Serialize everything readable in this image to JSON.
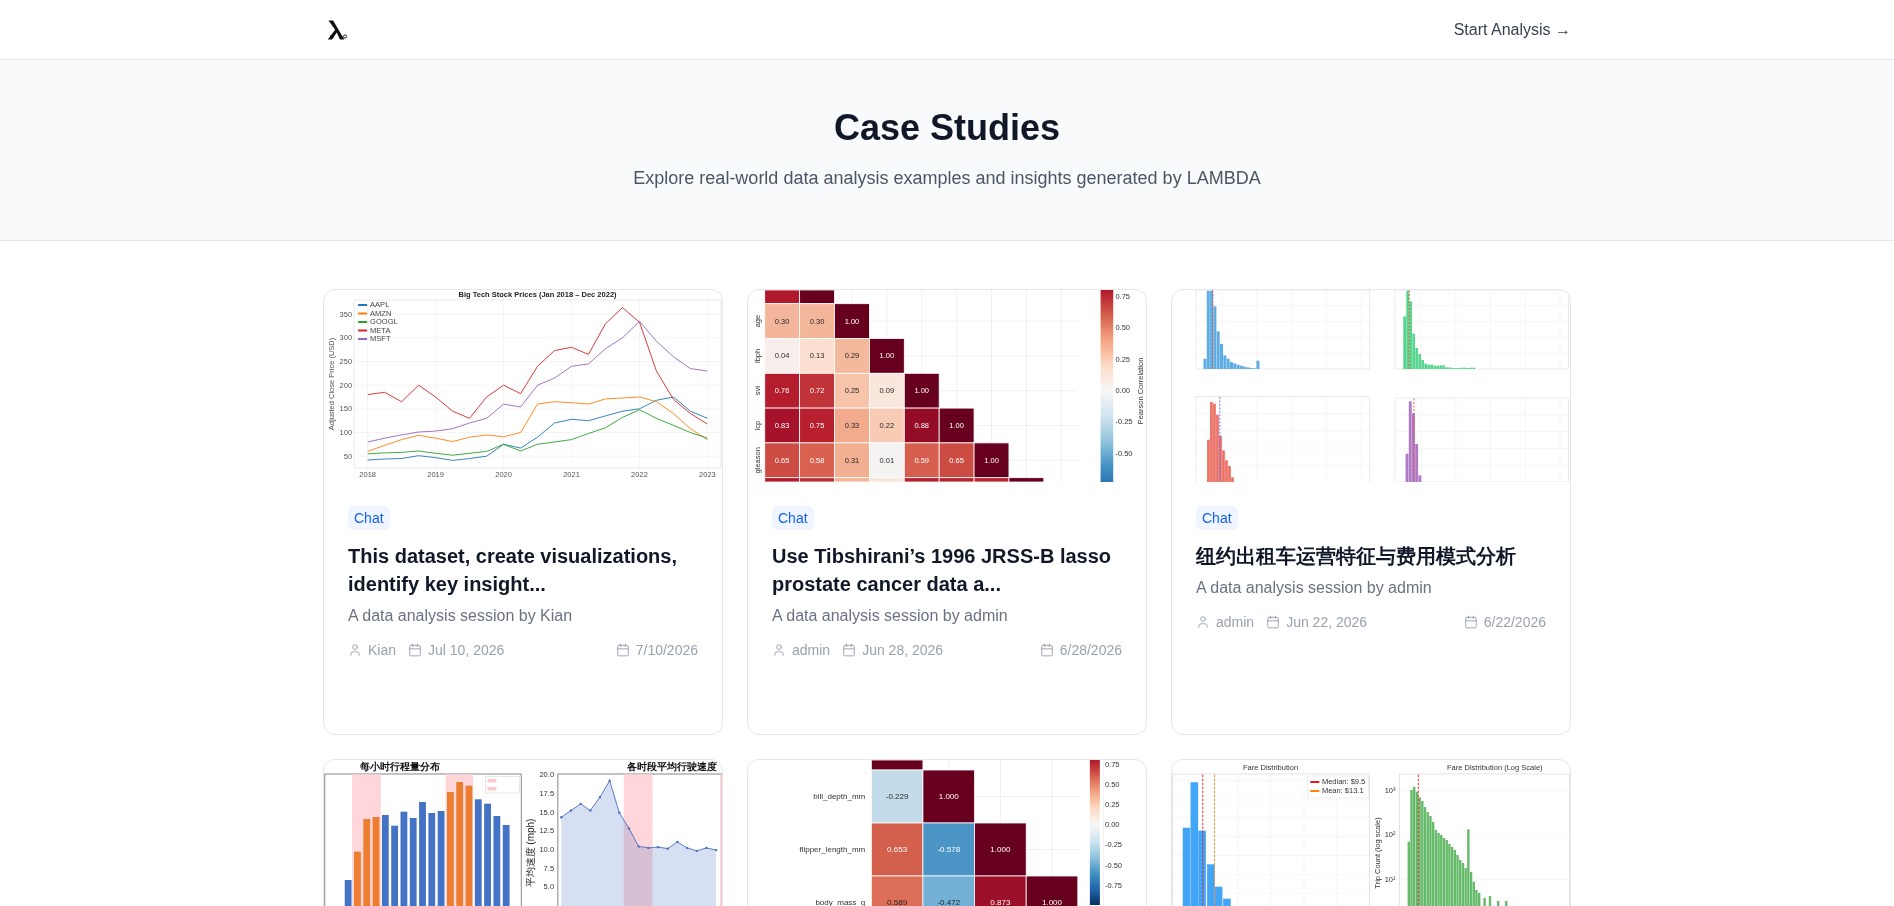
{
  "header": {
    "cta": "Start Analysis →"
  },
  "hero": {
    "title": "Case Studies",
    "subtitle": "Explore real-world data analysis examples and insights generated by LAMBDA"
  },
  "cards": [
    {
      "thumbnail": {
        "kind": "lines",
        "chart_data": {
          "type": "line",
          "title": "Big Tech Stock Prices (Jan 2018 – Dec 2022)",
          "ylabel": "Adjusted Close Price (USD)",
          "x": [
            2018,
            2018.25,
            2018.5,
            2018.75,
            2019,
            2019.25,
            2019.5,
            2019.75,
            2020,
            2020.25,
            2020.5,
            2020.75,
            2021,
            2021.25,
            2021.5,
            2021.75,
            2022,
            2022.25,
            2022.5,
            2022.75,
            2023
          ],
          "xlim": [
            2017.8,
            2023.2
          ],
          "ylim": [
            25,
            380
          ],
          "xticks": [
            2018,
            2019,
            2020,
            2021,
            2022,
            2023
          ],
          "yticks": [
            50,
            100,
            150,
            200,
            250,
            300,
            350
          ],
          "grid": true,
          "legend": "upper left",
          "series": [
            {
              "name": "AAPL",
              "color": "#1f77b4",
              "values": [
                42,
                44,
                45,
                51,
                47,
                41,
                45,
                50,
                75,
                67,
                90,
                120,
                128,
                125,
                135,
                145,
                150,
                168,
                175,
                145,
                130
              ]
            },
            {
              "name": "AMZN",
              "color": "#ff7f0e",
              "values": [
                60,
                73,
                85,
                94,
                88,
                81,
                90,
                95,
                91,
                100,
                160,
                165,
                163,
                160,
                171,
                173,
                175,
                165,
                140,
                108,
                85
              ]
            },
            {
              "name": "GOOGL",
              "color": "#2ca02c",
              "values": [
                55,
                57,
                58,
                61,
                56,
                52,
                56,
                60,
                75,
                61,
                75,
                80,
                85,
                98,
                110,
                132,
                148,
                130,
                115,
                100,
                88
              ]
            },
            {
              "name": "META",
              "color": "#d62728",
              "values": [
                180,
                185,
                165,
                200,
                175,
                145,
                130,
                175,
                200,
                182,
                240,
                273,
                280,
                265,
                330,
                364,
                333,
                230,
                170,
                140,
                118
              ]
            },
            {
              "name": "MSFT",
              "color": "#9467bd",
              "values": [
                80,
                88,
                95,
                101,
                103,
                108,
                120,
                130,
                160,
                154,
                200,
                215,
                240,
                245,
                277,
                300,
                335,
                293,
                260,
                235,
                230
              ]
            }
          ]
        }
      },
      "badge": "Chat",
      "title": "This dataset, create visualizations, identify key insight...",
      "subtitle": "A data analysis session by Kian",
      "author": "Kian",
      "created": "Jul 10, 2026",
      "updated": "7/10/2026"
    },
    {
      "thumbnail": {
        "kind": "heatmap",
        "rows": [
          {
            "cells": [
              {
                "color": "#b2182b"
              },
              {
                "color": "#67001f"
              }
            ]
          },
          {
            "label": "age",
            "cells": [
              {
                "value": "0.30",
                "color": "#f4b69a"
              },
              {
                "value": "0.30",
                "color": "#f4b69a"
              },
              {
                "value": "1.00",
                "color": "#67001f"
              }
            ]
          },
          {
            "label": "lbph",
            "cells": [
              {
                "value": "0.04",
                "color": "#f7efeb"
              },
              {
                "value": "0.13",
                "color": "#fbdfd0"
              },
              {
                "value": "0.29",
                "color": "#f4b89c"
              },
              {
                "value": "1.00",
                "color": "#67001f"
              }
            ]
          },
          {
            "label": "svi",
            "cells": [
              {
                "value": "0.76",
                "color": "#b41d2e"
              },
              {
                "value": "0.72",
                "color": "#bf3339"
              },
              {
                "value": "0.25",
                "color": "#f7c4aa"
              },
              {
                "value": "0.09",
                "color": "#f9e7dd"
              },
              {
                "value": "1.00",
                "color": "#67001f"
              }
            ]
          },
          {
            "label": "lcp",
            "cells": [
              {
                "value": "0.83",
                "color": "#a5122a"
              },
              {
                "value": "0.75",
                "color": "#b8202f"
              },
              {
                "value": "0.33",
                "color": "#f2ab8d"
              },
              {
                "value": "0.22",
                "color": "#f8cbb4"
              },
              {
                "value": "0.88",
                "color": "#950c26"
              },
              {
                "value": "1.00",
                "color": "#67001f"
              }
            ]
          },
          {
            "label": "gleason",
            "cells": [
              {
                "value": "0.65",
                "color": "#cc4c44"
              },
              {
                "value": "0.58",
                "color": "#d86150"
              },
              {
                "value": "0.31",
                "color": "#f3af91"
              },
              {
                "value": "0.01",
                "color": "#f5f3f2"
              },
              {
                "value": "0.59",
                "color": "#d65e4e"
              },
              {
                "value": "0.65",
                "color": "#cc4c44"
              },
              {
                "value": "1.00",
                "color": "#67001f"
              }
            ]
          },
          {
            "cells": [
              {
                "color": "#b31b2c"
              },
              {
                "color": "#bd2f37"
              },
              {
                "color": "#f4b497"
              },
              {
                "color": "#f7e4da"
              },
              {
                "color": "#b52030"
              },
              {
                "color": "#b7222f"
              },
              {
                "color": "#b82431"
              },
              {
                "color": "#67001f"
              }
            ]
          }
        ],
        "colorbar": {
          "label": "Pearson Correlation",
          "ticks": [
            "0.75",
            "0.50",
            "0.25",
            "0.00",
            "-0.25",
            "-0.50"
          ]
        }
      },
      "badge": "Chat",
      "title": "Use Tibshirani’s 1996 JRSS-B lasso prostate cancer data a...",
      "subtitle": "A data analysis session by admin",
      "author": "admin",
      "created": "Jun 28, 2026",
      "updated": "6/28/2026"
    },
    {
      "thumbnail": {
        "kind": "histograms"
      },
      "badge": "Chat",
      "title": "纽约出租车运营特征与费用模式分析",
      "subtitle": "A data analysis session by admin",
      "author": "admin",
      "created": "Jun 22, 2026",
      "updated": "6/22/2026"
    },
    {
      "thumbnail": {
        "kind": "combo",
        "left_title": "每小时行程量分布",
        "chart_data": {
          "type": "area",
          "title": "各时段平均行驶速度",
          "ylabel": "平均速度 (mph)",
          "ylim": [
            0,
            20.1
          ],
          "yticks": [
            {
              "value": 20,
              "label": "20.0"
            },
            {
              "value": 17.5,
              "label": "17.5"
            },
            {
              "value": 15,
              "label": "15.0"
            },
            {
              "value": 12.5,
              "label": "12.5"
            },
            {
              "value": 10,
              "label": "10.0"
            },
            {
              "value": 7.5,
              "label": "7.5"
            },
            {
              "value": 5,
              "label": "5.0"
            }
          ],
          "series": [
            {
              "color": "#4a6fc4",
              "values": [
                14.3,
                15.2,
                16.1,
                15.2,
                17.0,
                19.2,
                14.9,
                12.8,
                10.4,
                10.2,
                10.3,
                10.1,
                11.0,
                10.2,
                9.8,
                10.2,
                9.9
              ]
            }
          ]
        }
      }
    },
    {
      "thumbnail": {
        "kind": "matrix",
        "rows": [
          {
            "cells": [
              {
                "color": "#67001f"
              }
            ]
          },
          {
            "label": "bill_depth_mm",
            "cells": [
              {
                "value": "-0.229",
                "color": "#c4dcea"
              },
              {
                "value": "1.000",
                "color": "#67001f"
              }
            ]
          },
          {
            "label": "flipper_length_mm",
            "cells": [
              {
                "value": "0.653",
                "color": "#d3604d"
              },
              {
                "value": "-0.578",
                "color": "#4a95c5"
              },
              {
                "value": "1.000",
                "color": "#67001f"
              }
            ]
          },
          {
            "label": "body_mass_g",
            "cells": [
              {
                "value": "0.589",
                "color": "#dd6f58"
              },
              {
                "value": "-0.472",
                "color": "#72b0d6"
              },
              {
                "value": "0.873",
                "color": "#9b1028"
              },
              {
                "value": "1.000",
                "color": "#67001f"
              }
            ]
          }
        ],
        "colorbar": {
          "ticks": [
            "0.75",
            "0.50",
            "0.25",
            "0.00",
            "-0.25",
            "-0.50",
            "-0.75"
          ]
        }
      }
    },
    {
      "thumbnail": {
        "kind": "distribution",
        "left_title": "Fare Distribution",
        "right_title": "Fare Distribution (Log Scale)",
        "legend": [
          {
            "label": "Median: $9.5",
            "color": "#e41a1c"
          },
          {
            "label": "Mean: $13.1",
            "color": "#ff7f0e"
          }
        ],
        "ylabel": "Trip Count (log scale)",
        "yticks": [
          "10³",
          "10²",
          "10¹"
        ]
      }
    }
  ]
}
